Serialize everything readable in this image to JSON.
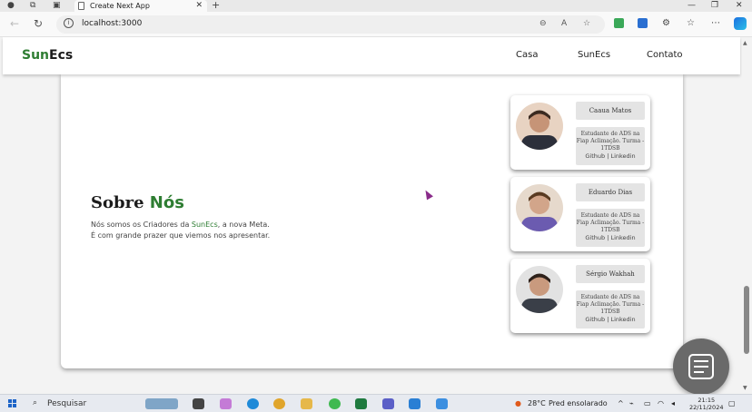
{
  "browser": {
    "tab_title": "Create Next App",
    "url": "localhost:3000",
    "new_tab": "+",
    "tab_close": "✕"
  },
  "site": {
    "logo": {
      "part1": "Sun",
      "part2": "Ecs"
    },
    "nav": [
      "Casa",
      "SunEcs",
      "Contato"
    ]
  },
  "about": {
    "title_part1": "Sobre ",
    "title_part2": "Nós",
    "line1_a": "Nós somos os Criadores da ",
    "line1_brand": "SunEcs",
    "line1_b": ", a nova Meta.",
    "line2": "É com grande prazer que viemos nos apresentar."
  },
  "members": [
    {
      "name": "Caaua Matos",
      "description": "Estudante de ADS na Fiap Aclimação. Turma - 1TDSB",
      "links": "Github | Linkedin",
      "shirt_color": "#2c2f3a",
      "skin_color": "#c69477"
    },
    {
      "name": "Eduardo Dias",
      "description": "Estudante de ADS na Fiap Aclimação. Turma - 1TDSB",
      "links": "Github | Linkedin",
      "shirt_color": "#6b5bb0",
      "skin_color": "#d2a58a"
    },
    {
      "name": "Sérgio Wakhah",
      "description": "Estudante de ADS na Fiap Aclimação. Turma - 1TDSB",
      "links": "Github | Linkedin",
      "shirt_color": "#3a3f48",
      "skin_color": "#c99a7e"
    }
  ],
  "taskbar": {
    "search_placeholder": "Pesquisar",
    "weather_temp": "28°C",
    "weather_desc": "Pred ensolarado",
    "time": "21:15",
    "date": "22/11/2024"
  },
  "colors": {
    "brand_green": "#2e7d32"
  }
}
